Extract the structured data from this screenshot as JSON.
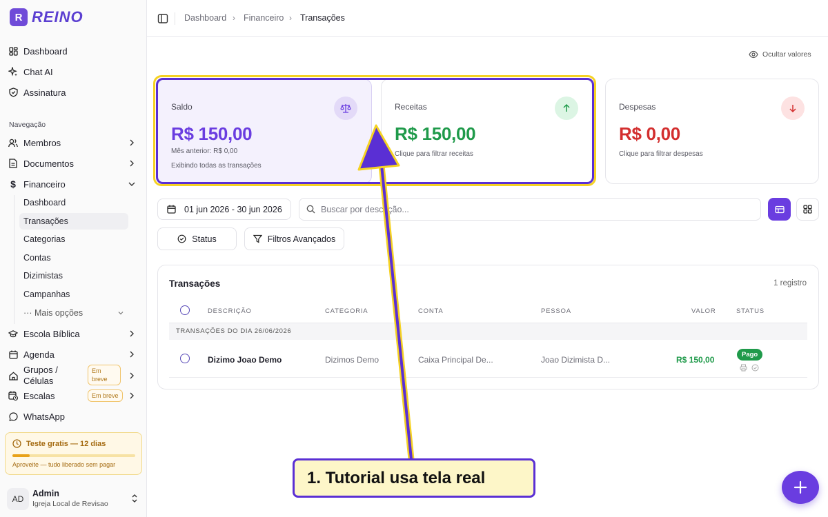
{
  "app": {
    "logo_text": "REINO",
    "logo_mark": "R"
  },
  "sidebar": {
    "top_items": [
      {
        "label": "Dashboard",
        "icon": "grid-icon"
      },
      {
        "label": "Chat AI",
        "icon": "sparkle-icon"
      },
      {
        "label": "Assinatura",
        "icon": "shield-icon"
      }
    ],
    "section_label": "Navegação",
    "items": [
      {
        "label": "Membros",
        "icon": "users-icon"
      },
      {
        "label": "Documentos",
        "icon": "document-icon"
      },
      {
        "label": "Financeiro",
        "icon": "dollar-icon",
        "expanded": true
      }
    ],
    "sub_items": [
      {
        "label": "Dashboard"
      },
      {
        "label": "Transações",
        "active": true
      },
      {
        "label": "Categorias"
      },
      {
        "label": "Contas"
      },
      {
        "label": "Dizimistas"
      },
      {
        "label": "Campanhas"
      },
      {
        "label": "··· Mais opções"
      }
    ],
    "lower_items": [
      {
        "label": "Escola Bíblica",
        "icon": "graduation-cap-icon"
      },
      {
        "label": "Agenda",
        "icon": "calendar-icon"
      },
      {
        "label_line1": "Grupos /",
        "label_line2": "Células",
        "icon": "home-icon",
        "badge": "Em breve"
      },
      {
        "label": "Escalas",
        "icon": "calendar-clock-icon",
        "badge": "Em breve"
      },
      {
        "label": "WhatsApp",
        "icon": "chat-bubble-icon"
      }
    ],
    "trial": {
      "title": "Teste gratis — 12 dias",
      "subtitle": "Aproveite — tudo liberado sem pagar",
      "progress": 0.14
    },
    "user": {
      "initials": "AD",
      "name": "Admin",
      "org": "Igreja Local de Revisao"
    }
  },
  "breadcrumb": [
    "Dashboard",
    "Financeiro",
    "Transações"
  ],
  "hide_values_label": "Ocultar valores",
  "cards": {
    "saldo": {
      "label": "Saldo",
      "value": "R$ 150,00",
      "sub1": "Mês anterior: R$ 0,00",
      "sub2": "Exibindo todas as transações",
      "color": "#6a3de0"
    },
    "receitas": {
      "label": "Receitas",
      "value": "R$ 150,00",
      "sub1": "Clique para filtrar receitas",
      "color": "#1f9a4a"
    },
    "despesas": {
      "label": "Despesas",
      "value": "R$ 0,00",
      "sub1": "Clique para filtrar despesas",
      "color": "#d32f2f"
    }
  },
  "filters": {
    "date_range": "01 jun 2026 - 30 jun 2026",
    "search_placeholder": "Buscar por descrição...",
    "status_label": "Status",
    "advanced_label": "Filtros Avançados"
  },
  "table": {
    "title": "Transações",
    "count": "1 registro",
    "columns": [
      "DESCRIÇÃO",
      "CATEGORIA",
      "CONTA",
      "PESSOA",
      "VALOR",
      "STATUS"
    ],
    "group_label": "TRANSAÇÕES DO DIA 26/06/2026",
    "rows": [
      {
        "descricao": "Dizimo Joao Demo",
        "categoria": "Dizimos Demo",
        "conta": "Caixa Principal De...",
        "pessoa": "Joao Dizimista D...",
        "valor": "R$ 150,00",
        "status": "Pago"
      }
    ]
  },
  "tutorial": {
    "text": "1. Tutorial usa tela real"
  },
  "colors": {
    "accent": "#6a3de0",
    "highlight_outer": "#f5d223",
    "positive": "#1f9a4a",
    "negative": "#d32f2f"
  }
}
